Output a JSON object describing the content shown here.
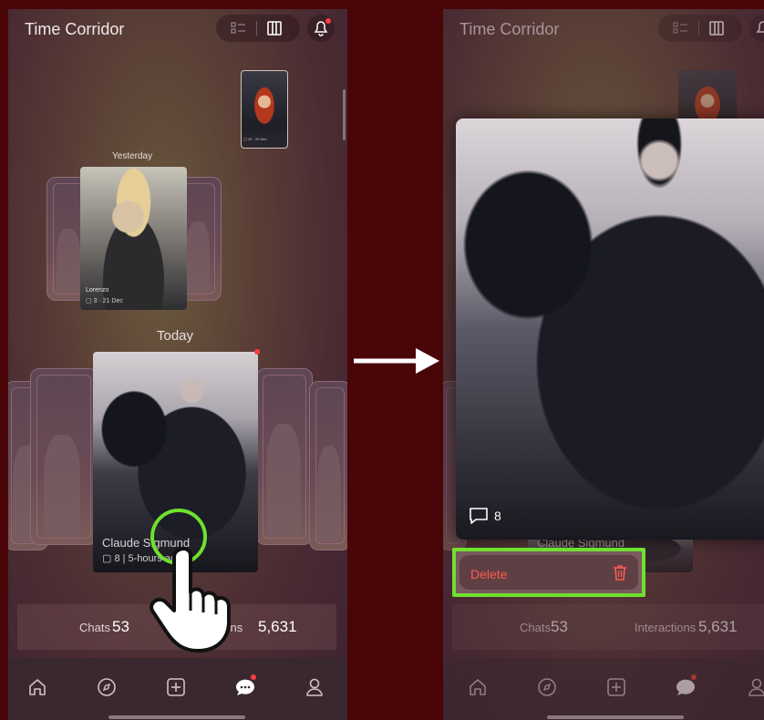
{
  "left_screen": {
    "header": {
      "title": "Time Corridor"
    },
    "sections": {
      "yesterday_label": "Yesterday",
      "today_label": "Today"
    },
    "small_card": {
      "meta": "▢ 10 · 20 Dec"
    },
    "lorenzo_card": {
      "name": "Lorenzo",
      "meta": "▢ 3 · 21 Dec"
    },
    "claude_card": {
      "name": "Claude Sigmund",
      "meta": "▢ 8 | 5-hours ago"
    },
    "stats": {
      "chats_label": "Chats",
      "chats_value": "53",
      "interactions_label": "Interactions",
      "interactions_value": "5,631"
    }
  },
  "right_screen": {
    "header": {
      "title": "Time Corridor"
    },
    "expanded_card": {
      "comment_count": "8",
      "name_behind": "Claude Sigmund"
    },
    "delete_action": {
      "label": "Delete"
    },
    "stats": {
      "chats_label": "Chats",
      "chats_value": "53",
      "interactions_label": "Interactions",
      "interactions_value": "5,631"
    }
  },
  "nav_items": [
    "home-icon",
    "compass-icon",
    "plus-square-icon",
    "chat-icon",
    "profile-icon"
  ],
  "colors": {
    "highlight": "#6fe02e",
    "delete_text": "#ff5a4e",
    "notification_dot": "#ff3b3b",
    "outer_background": "#4a0509"
  }
}
